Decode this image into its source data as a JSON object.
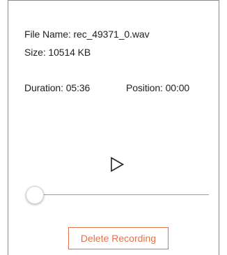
{
  "recording": {
    "file_name_text": "File Name: rec_49371_0.wav",
    "size_text": "Size: 10514 KB",
    "duration_text": "Duration: 05:36",
    "position_text": "Position: 00:00"
  },
  "player": {
    "play_icon": "play-icon",
    "seek_progress": 0
  },
  "actions": {
    "delete_label": "Delete Recording"
  },
  "colors": {
    "accent": "#e0734a",
    "text": "#222222",
    "track": "#9c9c9c"
  }
}
